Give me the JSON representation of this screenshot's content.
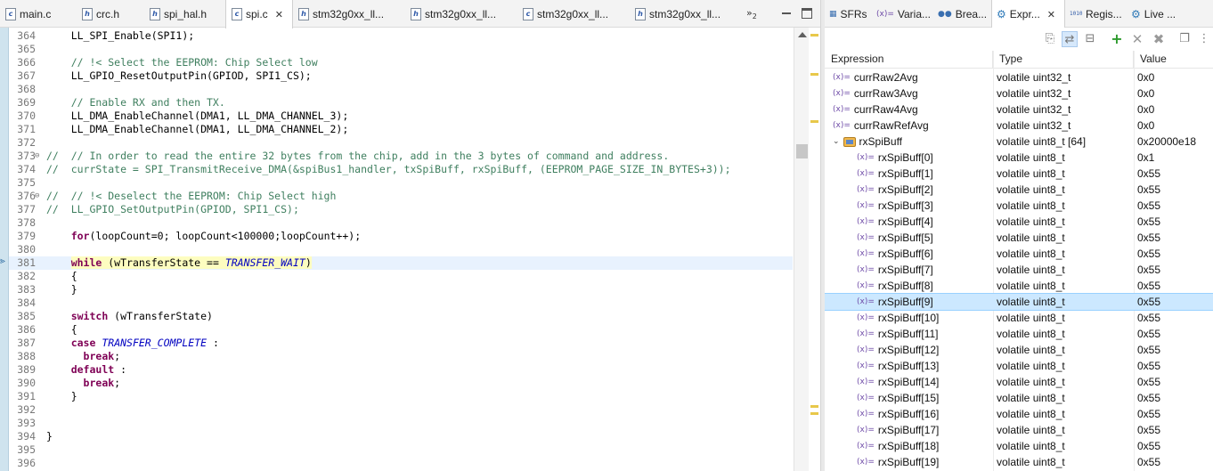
{
  "editor": {
    "tabs": [
      {
        "label": "main.c",
        "icon": "c",
        "left": 0
      },
      {
        "label": "crc.h",
        "icon": "h"
      },
      {
        "label": "spi_hal.h",
        "icon": "h"
      },
      {
        "label": "spi.c",
        "icon": "c",
        "active": true,
        "close": "✕"
      },
      {
        "label": "stm32g0xx_ll...",
        "icon": "h"
      },
      {
        "label": "stm32g0xx_ll...",
        "icon": "h"
      },
      {
        "label": "stm32g0xx_ll...",
        "icon": "c"
      },
      {
        "label": "stm32g0xx_ll...",
        "icon": "h"
      }
    ],
    "overflow_label": "»",
    "overflow_count": "2",
    "lines": [
      {
        "n": "364",
        "text": "    LL_SPI_Enable(SPI1);"
      },
      {
        "n": "365",
        "text": ""
      },
      {
        "n": "366",
        "text": "    // !< Select the EEPROM: Chip Select low",
        "style": "comment"
      },
      {
        "n": "367",
        "text": "    LL_GPIO_ResetOutputPin(GPIOD, SPI1_CS);"
      },
      {
        "n": "368",
        "text": ""
      },
      {
        "n": "369",
        "text": "    // Enable RX and then TX.",
        "style": "comment"
      },
      {
        "n": "370",
        "text": "    LL_DMA_EnableChannel(DMA1, LL_DMA_CHANNEL_3);"
      },
      {
        "n": "371",
        "text": "    LL_DMA_EnableChannel(DMA1, LL_DMA_CHANNEL_2);"
      },
      {
        "n": "372",
        "text": ""
      },
      {
        "n": "373",
        "text": "//  // In order to read the entire 32 bytes from the chip, add in the 3 bytes of command and address.",
        "style": "comment",
        "fold": "⊖"
      },
      {
        "n": "374",
        "text": "//  currState = SPI_TransmitReceive_DMA(&spiBus1_handler, txSpiBuff, rxSpiBuff, (EEPROM_PAGE_SIZE_IN_BYTES+3));",
        "style": "comment"
      },
      {
        "n": "375",
        "text": ""
      },
      {
        "n": "376",
        "text": "//  // !< Deselect the EEPROM: Chip Select high",
        "style": "comment",
        "fold": "⊖"
      },
      {
        "n": "377",
        "text": "//  LL_GPIO_SetOutputPin(GPIOD, SPI1_CS);",
        "style": "comment"
      },
      {
        "n": "378",
        "text": ""
      },
      {
        "n": "379",
        "text": "    for(loopCount=0; loopCount<100000;loopCount++);",
        "style": "for"
      },
      {
        "n": "380",
        "text": ""
      },
      {
        "n": "381",
        "text": "    while (wTransferState == TRANSFER_WAIT)",
        "style": "while",
        "current": true
      },
      {
        "n": "382",
        "text": "    {"
      },
      {
        "n": "383",
        "text": "    }"
      },
      {
        "n": "384",
        "text": ""
      },
      {
        "n": "385",
        "text": "    switch (wTransferState)",
        "style": "switch"
      },
      {
        "n": "386",
        "text": "    {"
      },
      {
        "n": "387",
        "text": "    case TRANSFER_COMPLETE :",
        "style": "case"
      },
      {
        "n": "388",
        "text": "      break;",
        "style": "break"
      },
      {
        "n": "389",
        "text": "    default :",
        "style": "default"
      },
      {
        "n": "390",
        "text": "      break;",
        "style": "break"
      },
      {
        "n": "391",
        "text": "    }"
      },
      {
        "n": "392",
        "text": ""
      },
      {
        "n": "393",
        "text": ""
      },
      {
        "n": "394",
        "text": "}"
      },
      {
        "n": "395",
        "text": ""
      },
      {
        "n": "396",
        "text": ""
      }
    ]
  },
  "view": {
    "tabs": [
      {
        "label": "SFRs",
        "icon": "▦"
      },
      {
        "label": "Varia...",
        "icon": "(x)="
      },
      {
        "label": "Brea...",
        "icon": "●●"
      },
      {
        "label": "Expr...",
        "icon": "⚙",
        "active": true,
        "close": "✕"
      },
      {
        "label": "Regis...",
        "icon": "1010"
      },
      {
        "label": "Live ...",
        "icon": "⚙"
      }
    ],
    "columns": {
      "expression": "Expression",
      "type": "Type",
      "value": "Value"
    },
    "rows": [
      {
        "name": "currRaw2Avg",
        "type": "volatile uint32_t",
        "value": "0x0",
        "indent": 0
      },
      {
        "name": "currRaw3Avg",
        "type": "volatile uint32_t",
        "value": "0x0",
        "indent": 0
      },
      {
        "name": "currRaw4Avg",
        "type": "volatile uint32_t",
        "value": "0x0",
        "indent": 0
      },
      {
        "name": "currRawRefAvg",
        "type": "volatile uint32_t",
        "value": "0x0",
        "indent": 0
      },
      {
        "name": "rxSpiBuff",
        "type": "volatile uint8_t [64]",
        "value": "0x20000e18",
        "indent": 0,
        "array": true
      },
      {
        "name": "rxSpiBuff[0]",
        "type": "volatile uint8_t",
        "value": "0x1",
        "indent": 1
      },
      {
        "name": "rxSpiBuff[1]",
        "type": "volatile uint8_t",
        "value": "0x55",
        "indent": 1
      },
      {
        "name": "rxSpiBuff[2]",
        "type": "volatile uint8_t",
        "value": "0x55",
        "indent": 1
      },
      {
        "name": "rxSpiBuff[3]",
        "type": "volatile uint8_t",
        "value": "0x55",
        "indent": 1
      },
      {
        "name": "rxSpiBuff[4]",
        "type": "volatile uint8_t",
        "value": "0x55",
        "indent": 1
      },
      {
        "name": "rxSpiBuff[5]",
        "type": "volatile uint8_t",
        "value": "0x55",
        "indent": 1
      },
      {
        "name": "rxSpiBuff[6]",
        "type": "volatile uint8_t",
        "value": "0x55",
        "indent": 1
      },
      {
        "name": "rxSpiBuff[7]",
        "type": "volatile uint8_t",
        "value": "0x55",
        "indent": 1
      },
      {
        "name": "rxSpiBuff[8]",
        "type": "volatile uint8_t",
        "value": "0x55",
        "indent": 1
      },
      {
        "name": "rxSpiBuff[9]",
        "type": "volatile uint8_t",
        "value": "0x55",
        "indent": 1,
        "selected": true
      },
      {
        "name": "rxSpiBuff[10]",
        "type": "volatile uint8_t",
        "value": "0x55",
        "indent": 1
      },
      {
        "name": "rxSpiBuff[11]",
        "type": "volatile uint8_t",
        "value": "0x55",
        "indent": 1
      },
      {
        "name": "rxSpiBuff[12]",
        "type": "volatile uint8_t",
        "value": "0x55",
        "indent": 1
      },
      {
        "name": "rxSpiBuff[13]",
        "type": "volatile uint8_t",
        "value": "0x55",
        "indent": 1
      },
      {
        "name": "rxSpiBuff[14]",
        "type": "volatile uint8_t",
        "value": "0x55",
        "indent": 1
      },
      {
        "name": "rxSpiBuff[15]",
        "type": "volatile uint8_t",
        "value": "0x55",
        "indent": 1
      },
      {
        "name": "rxSpiBuff[16]",
        "type": "volatile uint8_t",
        "value": "0x55",
        "indent": 1
      },
      {
        "name": "rxSpiBuff[17]",
        "type": "volatile uint8_t",
        "value": "0x55",
        "indent": 1
      },
      {
        "name": "rxSpiBuff[18]",
        "type": "volatile uint8_t",
        "value": "0x55",
        "indent": 1
      },
      {
        "name": "rxSpiBuff[19]",
        "type": "volatile uint8_t",
        "value": "0x55",
        "indent": 1
      }
    ]
  }
}
